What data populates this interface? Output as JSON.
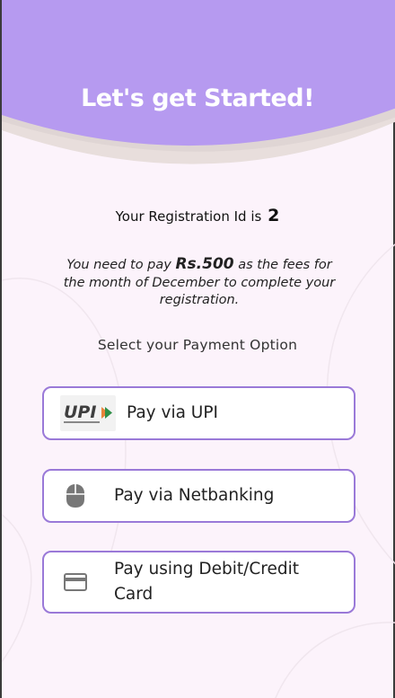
{
  "header": {
    "title": "Let's get Started!",
    "color": "#b69af0"
  },
  "registration": {
    "prefix": "Your Registration Id is",
    "id": "2"
  },
  "fees": {
    "before": "You need to pay ",
    "amount": "Rs.500",
    "after": " as the fees for the month of December to complete your registration."
  },
  "payment": {
    "heading": "Select your Payment Option",
    "options": [
      {
        "label": "Pay via UPI",
        "icon": "upi-logo"
      },
      {
        "label": "Pay via Netbanking",
        "icon": "mouse-icon"
      },
      {
        "label": "Pay using Debit/Credit Card",
        "icon": "credit-card-icon"
      }
    ]
  },
  "upi_logo_text": "UPI",
  "colors": {
    "accent": "#9a79d8",
    "background": "#fcf3fb",
    "icon": "#777777"
  }
}
